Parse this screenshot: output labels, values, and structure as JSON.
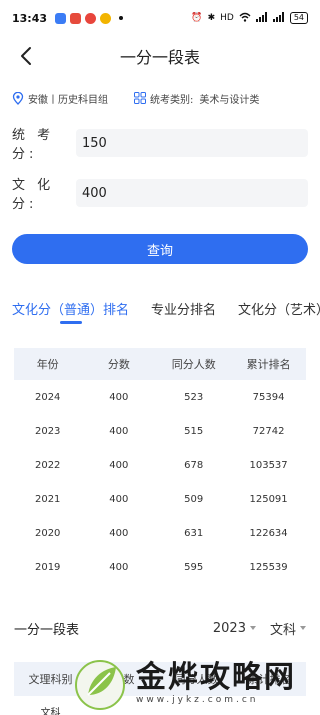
{
  "status_bar": {
    "time": "13:43",
    "right_text": "HD",
    "battery": "54"
  },
  "header": {
    "title": "一分一段表",
    "back_icon": "chevron-left-icon"
  },
  "info": {
    "location": "安徽丨历史科目组",
    "exam_type_label": "统考类别:",
    "exam_type_value": "美术与设计类"
  },
  "form": {
    "exam_score_label": "统 考 分:",
    "exam_score_value": "150",
    "culture_score_label": "文 化 分:",
    "culture_score_value": "400"
  },
  "query_button": "查询",
  "tabs": [
    {
      "label": "文化分（普通）排名",
      "active": true
    },
    {
      "label": "专业分排名",
      "active": false
    },
    {
      "label": "文化分（艺术）",
      "active": false
    }
  ],
  "rank_table": {
    "headers": [
      "年份",
      "分数",
      "同分人数",
      "累计排名"
    ],
    "rows": [
      [
        "2024",
        "400",
        "523",
        "75394"
      ],
      [
        "2023",
        "400",
        "515",
        "72742"
      ],
      [
        "2022",
        "400",
        "678",
        "103537"
      ],
      [
        "2021",
        "400",
        "509",
        "125091"
      ],
      [
        "2020",
        "400",
        "631",
        "122634"
      ],
      [
        "2019",
        "400",
        "595",
        "125539"
      ]
    ]
  },
  "segment": {
    "title": "一分一段表",
    "year": "2023",
    "subject": "文科",
    "headers": [
      "文理科别",
      "分数",
      "同分人数",
      "累计排名"
    ],
    "rows": [
      [
        "文科",
        "",
        "",
        ""
      ]
    ]
  },
  "watermark": {
    "main": "金烨攻略网",
    "sub": "www.jykz.com.cn"
  },
  "colors": {
    "accent": "#2f6ef0",
    "table_header_bg": "#eef2f9",
    "input_bg": "#f4f5f7"
  }
}
